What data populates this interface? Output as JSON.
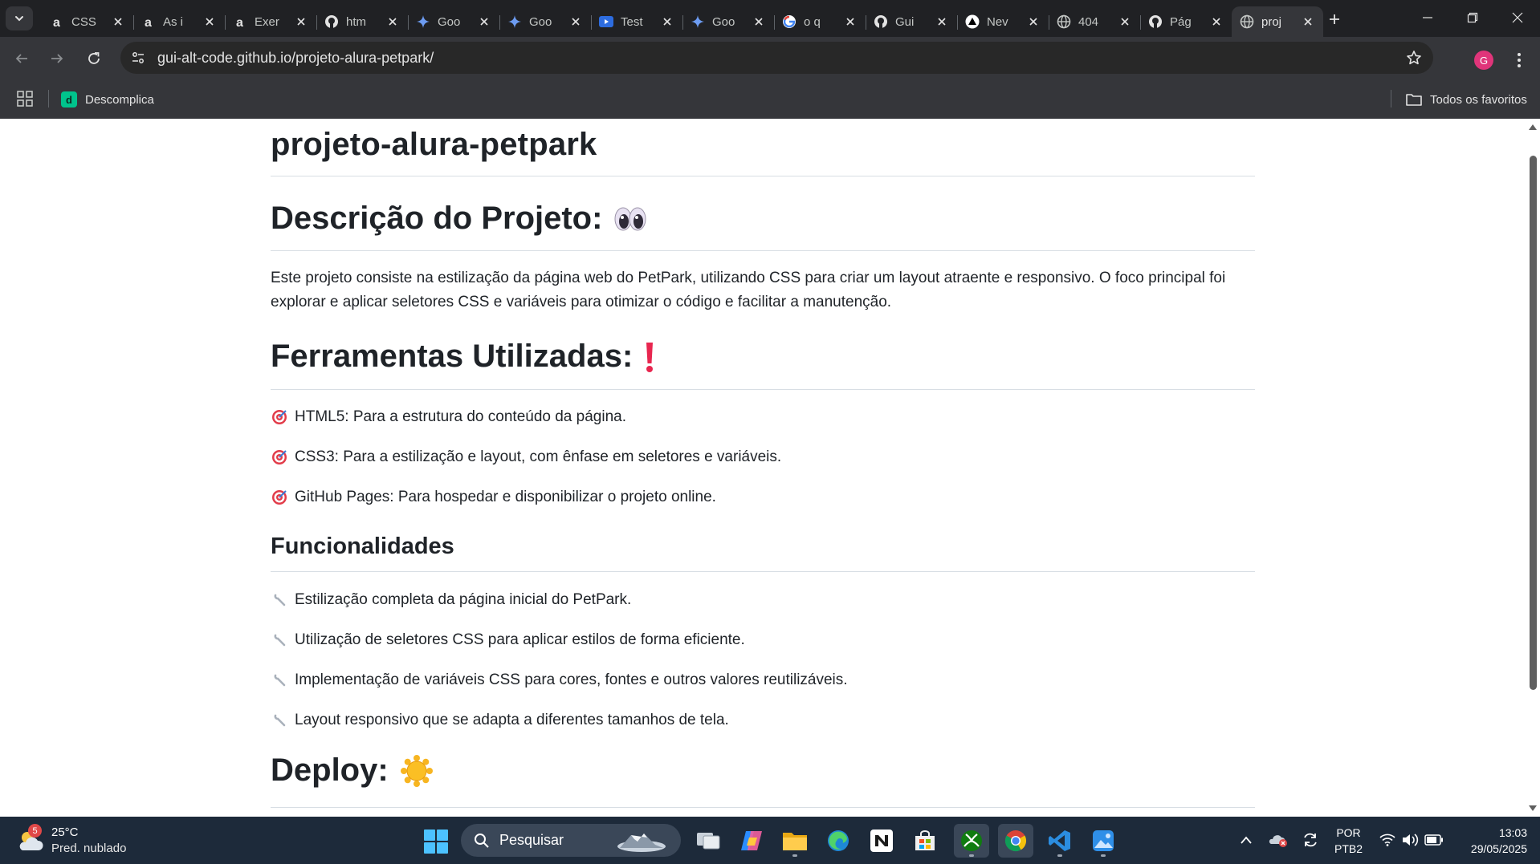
{
  "browser": {
    "tabs": [
      {
        "title": "CSS",
        "icon": "alura-icon"
      },
      {
        "title": "As i",
        "icon": "alura-icon"
      },
      {
        "title": "Exer",
        "icon": "alura-icon"
      },
      {
        "title": "htm",
        "icon": "github-icon"
      },
      {
        "title": "Goo",
        "icon": "gemini-icon"
      },
      {
        "title": "Goo",
        "icon": "gemini-icon"
      },
      {
        "title": "Test",
        "icon": "youtube-icon"
      },
      {
        "title": "Goo",
        "icon": "gemini-icon"
      },
      {
        "title": "o q",
        "icon": "google-icon"
      },
      {
        "title": "Gui",
        "icon": "github-icon"
      },
      {
        "title": "Nev",
        "icon": "triangle-icon"
      },
      {
        "title": "404",
        "icon": "globe-icon"
      },
      {
        "title": "Pág",
        "icon": "github-icon"
      },
      {
        "title": "proj",
        "icon": "globe-icon",
        "active": true
      }
    ],
    "url": "gui-alt-code.github.io/projeto-alura-petpark/",
    "profile_initial": "G",
    "bookmarks": [
      {
        "label": "Descomplica",
        "favicon_letter": "d"
      }
    ],
    "all_bookmarks_label": "Todos os favoritos"
  },
  "page": {
    "title": "projeto-alura-petpark",
    "sections": {
      "descricao": {
        "heading": "Descrição do Projeto:",
        "text": "Este projeto consiste na estilização da página web do PetPark, utilizando CSS para criar um layout atraente e responsivo. O foco principal foi explorar e aplicar seletores CSS e variáveis para otimizar o código e facilitar a manutenção."
      },
      "ferramentas": {
        "heading": "Ferramentas Utilizadas:",
        "items": [
          "HTML5: Para a estrutura do conteúdo da página.",
          "CSS3: Para a estilização e layout, com ênfase em seletores e variáveis.",
          "GitHub Pages: Para hospedar e disponibilizar o projeto online."
        ]
      },
      "funcionalidades": {
        "heading": "Funcionalidades",
        "items": [
          "Estilização completa da página inicial do PetPark.",
          "Utilização de seletores CSS para aplicar estilos de forma eficiente.",
          "Implementação de variáveis CSS para cores, fontes e outros valores reutilizáveis.",
          "Layout responsivo que se adapta a diferentes tamanhos de tela."
        ]
      },
      "deploy": {
        "heading": "Deploy:"
      }
    }
  },
  "taskbar": {
    "weather": {
      "temp": "25°C",
      "condition": "Pred. nublado",
      "badge": "5"
    },
    "search_placeholder": "Pesquisar",
    "lang_line1": "POR",
    "lang_line2": "PTB2",
    "time": "13:03",
    "date": "29/05/2025"
  },
  "colors": {
    "tab_bar": "#202124",
    "toolbar": "#35363a",
    "link_accent": "#e0357a",
    "taskbar": "#1d2a3a"
  }
}
